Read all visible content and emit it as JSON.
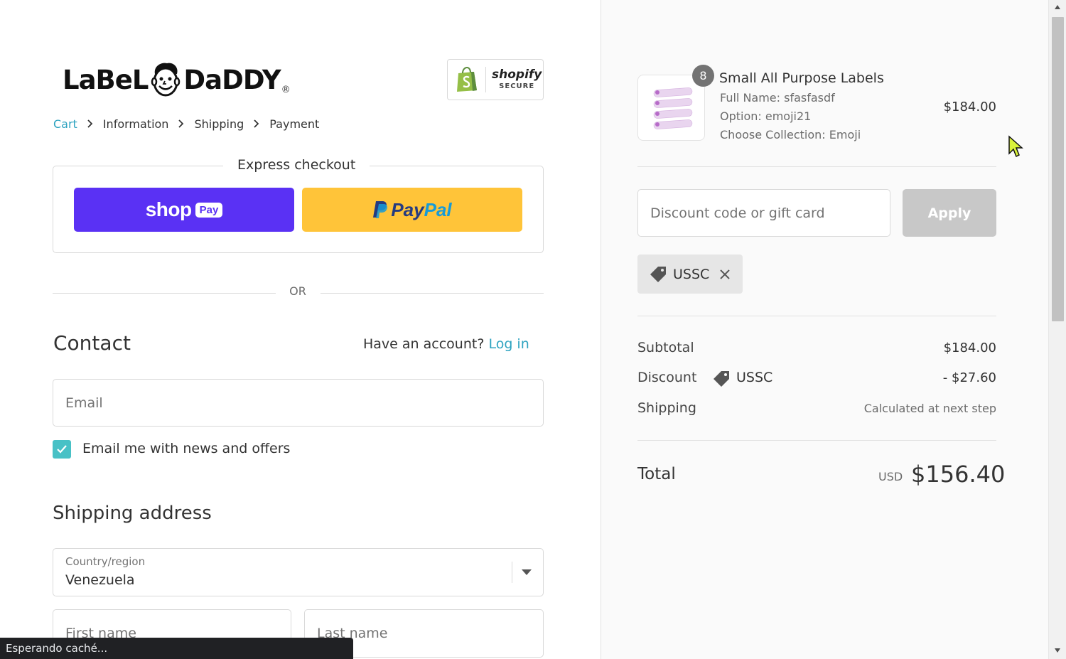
{
  "brand": {
    "logo_text_left": "LaBeL",
    "logo_text_right": "DaDDY",
    "logo_reg": "®"
  },
  "security_badge": {
    "name": "shopify",
    "tagline": "SECURE"
  },
  "breadcrumb": [
    {
      "label": "Cart"
    },
    {
      "label": "Information"
    },
    {
      "label": "Shipping"
    },
    {
      "label": "Payment"
    }
  ],
  "express_checkout": {
    "title": "Express checkout",
    "shop_pay": {
      "word": "shop",
      "pill": "Pay"
    },
    "paypal": {
      "pay": "Pay",
      "pal": "Pal"
    },
    "separator": "OR"
  },
  "contact": {
    "heading": "Contact",
    "account_prompt": "Have an account?",
    "login_link": "Log in",
    "email_placeholder": "Email",
    "newsletter_label": "Email me with news and offers",
    "newsletter_checked": true
  },
  "shipping_address": {
    "heading": "Shipping address",
    "country_label": "Country/region",
    "country_value": "Venezuela",
    "first_name_placeholder": "First name",
    "last_name_placeholder": "Last name"
  },
  "status_bar": "Esperando caché...",
  "order": {
    "product": {
      "quantity": "8",
      "name": "Small All Purpose Labels",
      "properties": [
        "Full Name: sfasfasdf",
        "Option: emoji21",
        "Choose Collection: Emoji"
      ],
      "price": "$184.00"
    },
    "discount_placeholder": "Discount code or gift card",
    "apply_label": "Apply",
    "applied_code": "USSC",
    "summary": {
      "subtotal_label": "Subtotal",
      "subtotal_value": "$184.00",
      "discount_label": "Discount",
      "discount_code": "USSC",
      "discount_value": "- $27.60",
      "shipping_label": "Shipping",
      "shipping_value": "Calculated at next step"
    },
    "total": {
      "label": "Total",
      "currency": "USD",
      "amount": "$156.40"
    }
  },
  "colors": {
    "link": "#2ea3c0",
    "shop_pay": "#5a31f4",
    "paypal": "#ffc439",
    "checkbox": "#48c1c6",
    "apply_disabled": "#c8c8c8"
  }
}
